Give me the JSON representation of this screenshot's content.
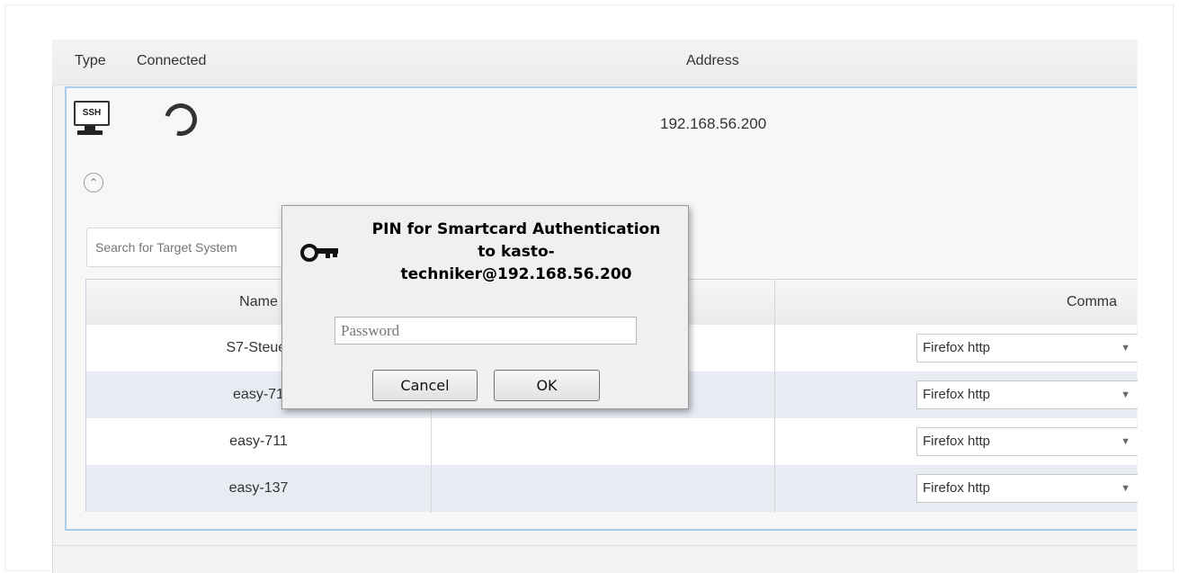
{
  "header": {
    "col_type": "Type",
    "col_connected": "Connected",
    "col_address": "Address"
  },
  "connection": {
    "type_badge": "SSH",
    "address": "192.168.56.200",
    "type_icon": "ssh-monitor-icon",
    "status_icon": "loading-spinner-icon"
  },
  "search": {
    "placeholder": "Search for Target System"
  },
  "table": {
    "columns": {
      "name": "Name",
      "command": "Comma"
    },
    "rows": [
      {
        "name": "S7-Steuer",
        "command": "Firefox http"
      },
      {
        "name": "easy-71",
        "command": "Firefox http"
      },
      {
        "name": "easy-711",
        "command": "Firefox http"
      },
      {
        "name": "easy-137",
        "command": "Firefox http"
      }
    ]
  },
  "dialog": {
    "title_line1": "PIN for Smartcard Authentication",
    "title_line2": "to kasto-",
    "title_line3": "techniker@192.168.56.200",
    "password_placeholder": "Password",
    "cancel_label": "Cancel",
    "ok_label": "OK",
    "icon": "key-icon"
  },
  "colors": {
    "accent_border": "#a9cdea",
    "row_alt": "#e7ecf3"
  }
}
